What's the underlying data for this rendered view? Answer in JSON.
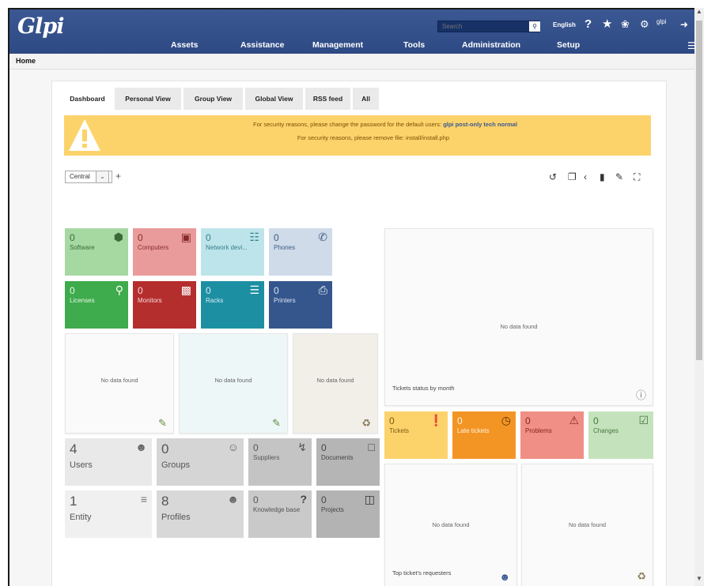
{
  "app": {
    "logo": "Glpi"
  },
  "header": {
    "search_placeholder": "Search",
    "language": "English",
    "username": "glpi",
    "menu": [
      "Assets",
      "Assistance",
      "Management",
      "Tools",
      "Administration",
      "Setup"
    ]
  },
  "breadcrumb": {
    "home": "Home"
  },
  "tabs": [
    "Dashboard",
    "Personal View",
    "Group View",
    "Global View",
    "RSS feed",
    "All"
  ],
  "alert": {
    "line1_prefix": "For security reasons, please change the password for the default users: ",
    "line1_users": "glpi post-only tech normal",
    "line2": "For security reasons, please remove file: install/install.php"
  },
  "dashboard": {
    "selected": "Central",
    "add": "+"
  },
  "colors": {
    "header": "#3b5893",
    "alert": "#fcd36b"
  },
  "asset_cards": [
    {
      "value": "0",
      "label": "Software",
      "icon": "cube-icon"
    },
    {
      "value": "0",
      "label": "Computers",
      "icon": "laptop-icon"
    },
    {
      "value": "0",
      "label": "Network devi...",
      "icon": "network-icon"
    },
    {
      "value": "0",
      "label": "Phones",
      "icon": "phone-icon"
    },
    {
      "value": "0",
      "label": "Licenses",
      "icon": "key-icon"
    },
    {
      "value": "0",
      "label": "Monitors",
      "icon": "monitor-icon"
    },
    {
      "value": "0",
      "label": "Racks",
      "icon": "server-icon"
    },
    {
      "value": "0",
      "label": "Printers",
      "icon": "printer-icon"
    }
  ],
  "no_data": "No data found",
  "tickets_status_title": "Tickets status by month",
  "ticket_cards": [
    {
      "value": "0",
      "label": "Tickets",
      "icon": "exclamation-icon"
    },
    {
      "value": "0",
      "label": "Late tickets",
      "icon": "clock-icon"
    },
    {
      "value": "0",
      "label": "Problems",
      "icon": "warning-icon"
    },
    {
      "value": "0",
      "label": "Changes",
      "icon": "clipboard-icon"
    }
  ],
  "admin_cards": [
    {
      "value": "4",
      "label": "Users",
      "icon": "user-icon"
    },
    {
      "value": "0",
      "label": "Groups",
      "icon": "group-icon"
    },
    {
      "value": "0",
      "label": "Suppliers",
      "icon": "dolly-icon"
    },
    {
      "value": "0",
      "label": "Documents",
      "icon": "file-icon"
    },
    {
      "value": "1",
      "label": "Entity",
      "icon": "layers-icon"
    },
    {
      "value": "8",
      "label": "Profiles",
      "icon": "user-check-icon"
    },
    {
      "value": "0",
      "label": "Knowledge base",
      "icon": "question-icon"
    },
    {
      "value": "0",
      "label": "Projects",
      "icon": "columns-icon"
    }
  ],
  "top_requesters_title": "Top ticket's requesters"
}
